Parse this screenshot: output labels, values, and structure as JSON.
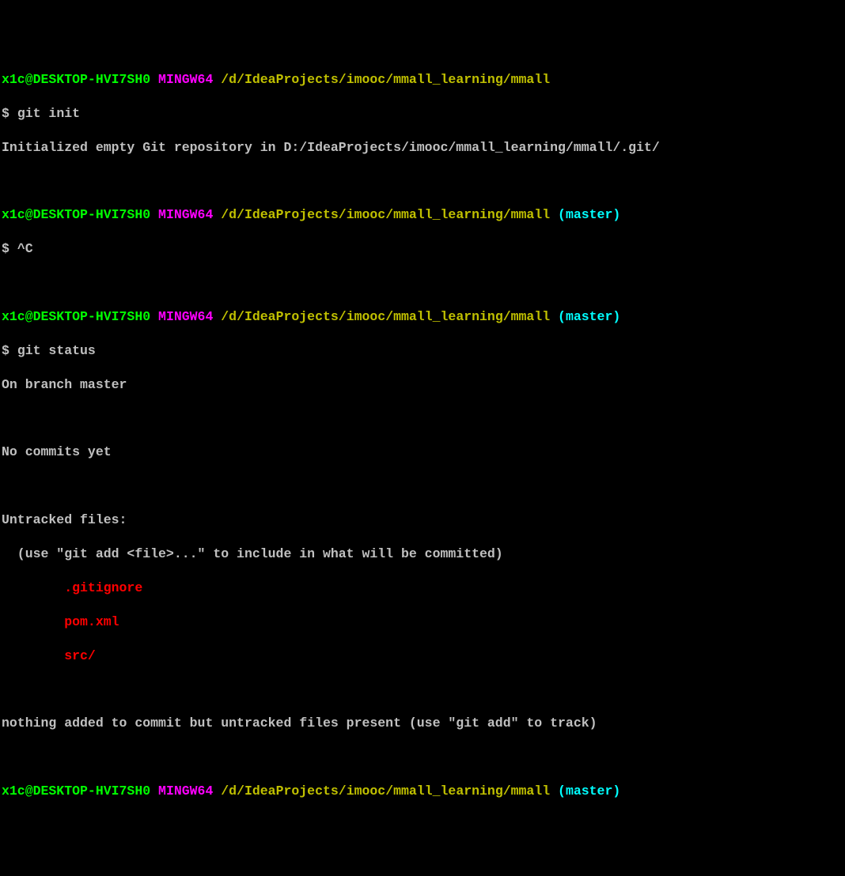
{
  "prompt": {
    "user_host": "x1c@DESKTOP-HVI7SH0",
    "shell": "MINGW64",
    "path": "/d/IdeaProjects/imooc/mmall_learning/mmall",
    "branch": "(master)",
    "sigil": "$"
  },
  "commands": {
    "git_init": "git init",
    "ctrl_c": "^C",
    "git_status": "git status"
  },
  "output": {
    "init_result": "Initialized empty Git repository in D:/IdeaProjects/imooc/mmall_learning/mmall/.git/",
    "on_branch": "On branch master",
    "no_commits": "No commits yet",
    "untracked_header": "Untracked files:",
    "untracked_hint": "  (use \"git add <file>...\" to include in what will be committed)",
    "untracked_files": {
      "f1": "        .gitignore",
      "f2": "        pom.xml",
      "f3": "        src/"
    },
    "nothing_added": "nothing added to commit but untracked files present (use \"git add\" to track)"
  }
}
